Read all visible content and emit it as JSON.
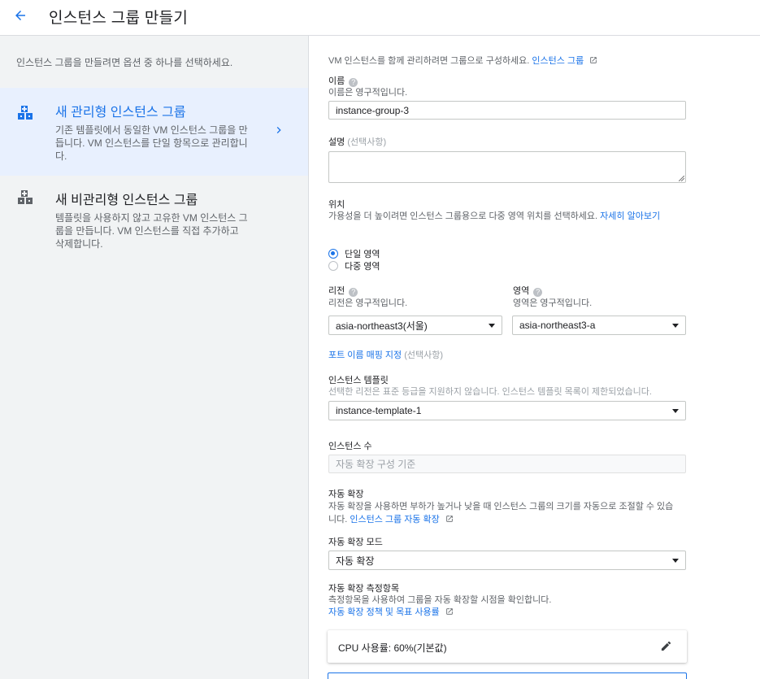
{
  "header": {
    "title": "인스턴스 그룹 만들기"
  },
  "left": {
    "intro": "인스턴스 그룹을 만들려면 옵션 중 하나를 선택하세요.",
    "options": [
      {
        "title": "새 관리형 인스턴스 그룹",
        "desc": "기존 템플릿에서 동일한 VM 인스턴스 그룹을 만듭니다. VM 인스턴스를 단일 항목으로 관리합니다.",
        "icon": "managed-group-icon",
        "selected": true
      },
      {
        "title": "새 비관리형 인스턴스 그룹",
        "desc": "템플릿을 사용하지 않고 고유한 VM 인스턴스 그룹을 만듭니다. VM 인스턴스를 직접 추가하고 삭제합니다.",
        "icon": "unmanaged-group-icon",
        "selected": false
      }
    ]
  },
  "form": {
    "intro": "VM 인스턴스를 함께 관리하려면 그룹으로 구성하세요.",
    "intro_link": "인스턴스 그룹",
    "name": {
      "label": "이름",
      "hint": "이름은 영구적입니다.",
      "value": "instance-group-3"
    },
    "description": {
      "label": "설명",
      "optional": "(선택사항)",
      "value": ""
    },
    "location": {
      "label": "위치",
      "desc": "가용성을 더 높이려면 인스턴스 그룹용으로 다중 영역 위치를 선택하세요.",
      "link": "자세히 알아보기",
      "options": [
        "단일 영역",
        "다중 영역"
      ],
      "selected": "단일 영역"
    },
    "region": {
      "label": "리전",
      "hint": "리전은 영구적입니다.",
      "value": "asia-northeast3(서울)"
    },
    "zone": {
      "label": "영역",
      "hint": "영역은 영구적입니다.",
      "value": "asia-northeast3-a"
    },
    "port_mapping": {
      "link": "포트 이름 매핑 지정",
      "optional": "(선택사항)"
    },
    "template": {
      "label": "인스턴스 템플릿",
      "hint": "선택한 리전은 표준 등급을 지원하지 않습니다. 인스턴스 템플릿 목록이 제한되었습니다.",
      "value": "instance-template-1"
    },
    "instance_count": {
      "label": "인스턴스 수",
      "placeholder": "자동 확장 구성 기준"
    },
    "autoscaling": {
      "label": "자동 확장",
      "desc": "자동 확장을 사용하면 부하가 높거나 낮을 때 인스턴스 그룹의 크기를 자동으로 조절할 수 있습니다.",
      "link": "인스턴스 그룹 자동 확장"
    },
    "autoscaling_mode": {
      "label": "자동 확장 모드",
      "value": "자동 확장"
    },
    "metrics": {
      "label": "자동 확장 측정항목",
      "desc": "측정항목을 사용하여 그룹을 자동 확장할 시점을 확인합니다.",
      "link": "자동 확장 정책 및 목표 사용률"
    },
    "cpu_card": {
      "text": "CPU 사용률: 60%(기본값)"
    }
  },
  "colors": {
    "accent": "#1a73e8",
    "left_bg": "#f1f3f4",
    "selected_bg": "#e8f0fe"
  }
}
